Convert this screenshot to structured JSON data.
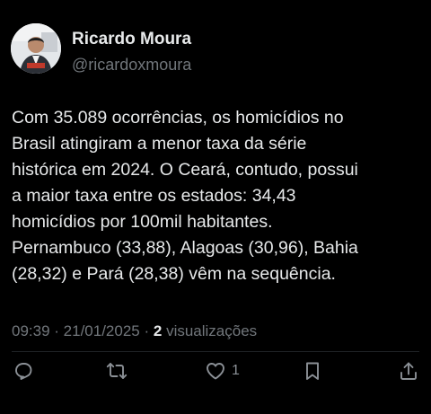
{
  "author": {
    "display_name": "Ricardo Moura",
    "handle": "@ricardoxmoura"
  },
  "post": {
    "text": "Com 35.089 ocorrências, os homicídios no\nBrasil atingiram a menor taxa da série\nhistórica em 2024. O Ceará, contudo, possui\na maior taxa entre os estados: 34,43\nhomicídios por 100mil habitantes.\nPernambuco (33,88), Alagoas (30,96), Bahia\n(28,32) e Pará (28,38) vêm na sequência."
  },
  "meta": {
    "time": "09:39",
    "separator": " · ",
    "date": "21/01/2025",
    "views_count": "2",
    "views_label": "visualizações"
  },
  "actions": {
    "reply_icon": "reply-icon",
    "retweet_icon": "retweet-icon",
    "like_icon": "heart-icon",
    "like_count": "1",
    "bookmark_icon": "bookmark-icon",
    "share_icon": "share-icon"
  },
  "colors": {
    "background": "#000000",
    "text_primary": "#e7e9ea",
    "text_secondary": "#71767b"
  }
}
